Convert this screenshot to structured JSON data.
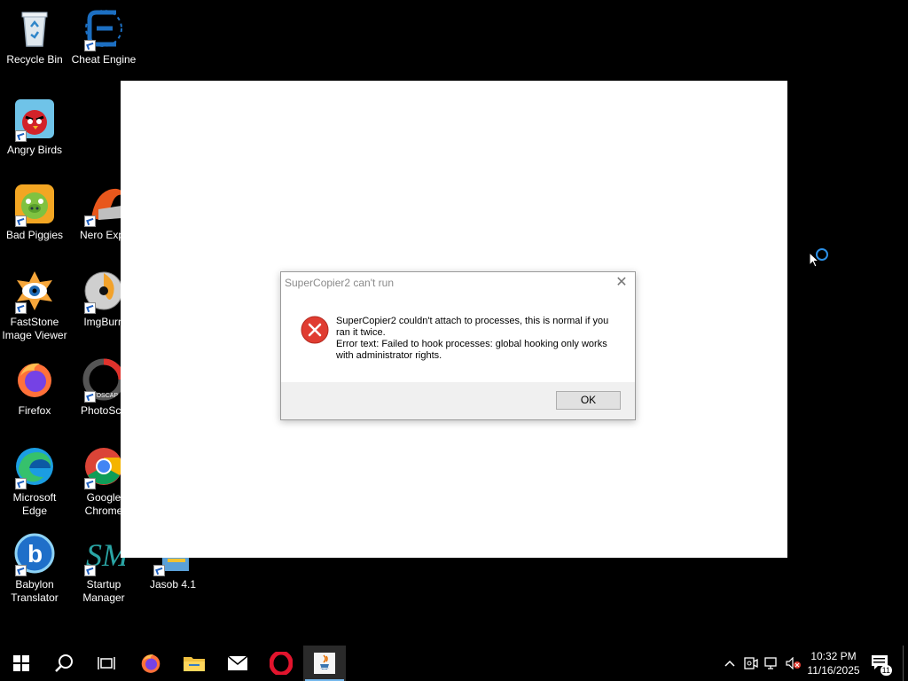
{
  "desktop_icons": [
    {
      "label": "Recycle Bin"
    },
    {
      "label": "Cheat Engine"
    },
    {
      "label": "Angry Birds"
    },
    {
      "label": "Bad Piggies"
    },
    {
      "label": "Nero Expr"
    },
    {
      "label": "FastStone Image Viewer"
    },
    {
      "label": "ImgBurn"
    },
    {
      "label": "Firefox"
    },
    {
      "label": "PhotoSca"
    },
    {
      "label": "Microsoft Edge"
    },
    {
      "label": "Google Chrome"
    },
    {
      "label": "Babylon Translator"
    },
    {
      "label": "Startup Manager"
    },
    {
      "label": "Jasob 4.1"
    }
  ],
  "dialog": {
    "title": "SuperCopier2 can't run",
    "message_line1": "SuperCopier2 couldn't attach to processes, this is normal if you ran it twice.",
    "message_line2": "Error text: Failed to hook processes: global hooking only works with administrator rights.",
    "ok_label": "OK",
    "close_glyph": "✕"
  },
  "taskbar": {
    "time": "10:32 PM",
    "date": "11/16/2025",
    "notification_count": "11",
    "apps": [
      "start",
      "search",
      "task-view",
      "firefox",
      "file-explorer",
      "mail",
      "opera",
      "java"
    ]
  },
  "colors": {
    "accent": "#2b8fe6",
    "error": "#e03c31",
    "desktop": "#000000"
  }
}
